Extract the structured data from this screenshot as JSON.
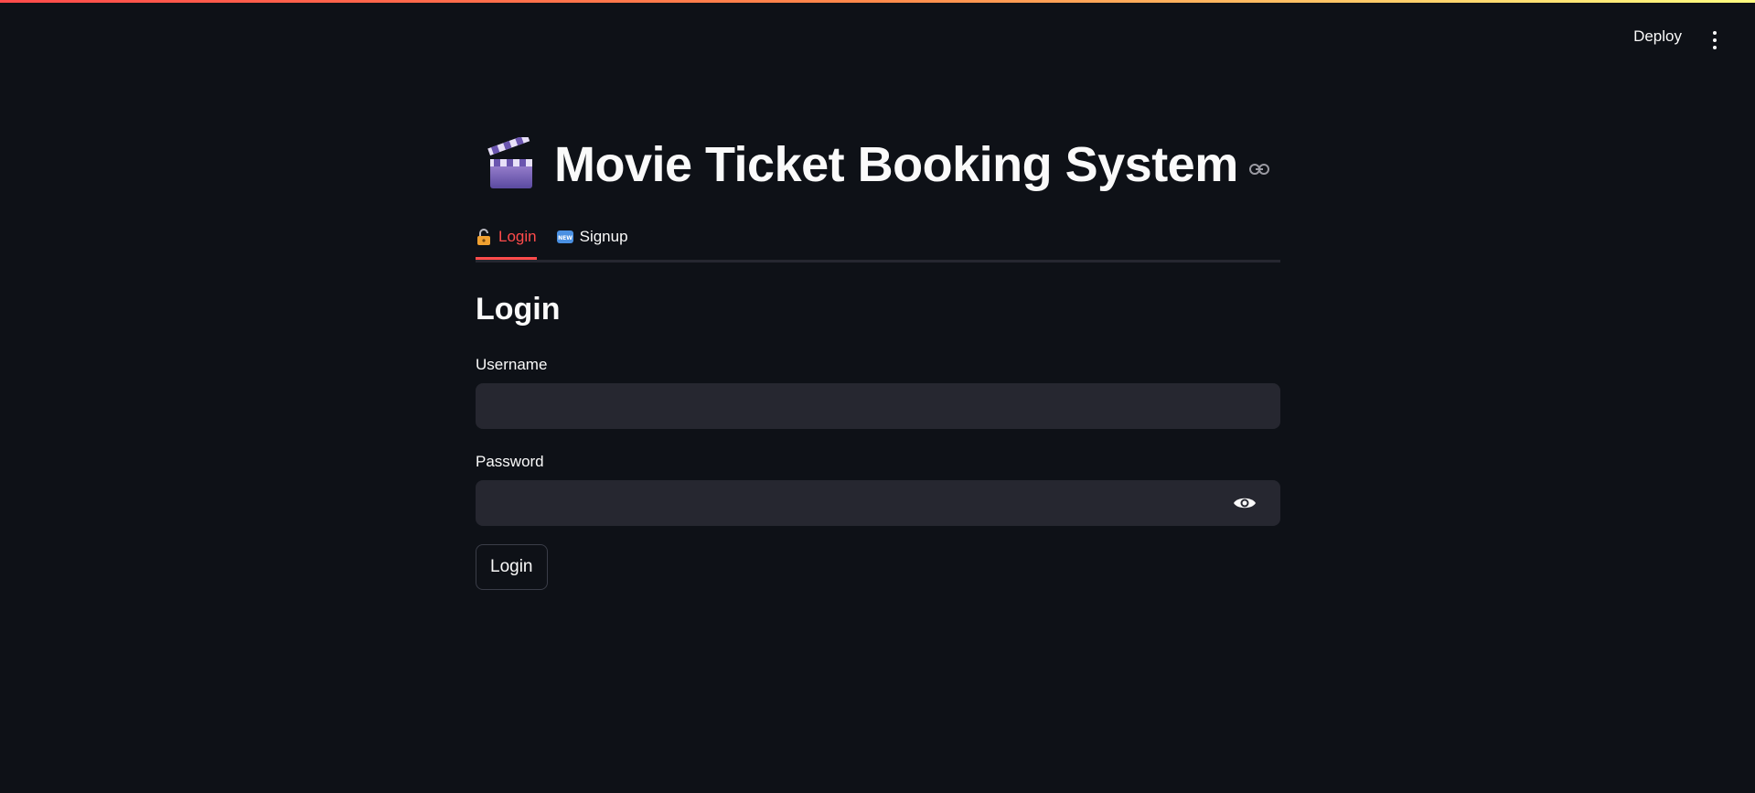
{
  "header": {
    "deploy_label": "Deploy",
    "menu_icon": "kebab-menu-icon",
    "decoration_colors": [
      "#ff4b4b",
      "#fffd80"
    ]
  },
  "main": {
    "title": "Movie Ticket Booking System",
    "title_icon": "clapper-board-icon",
    "tabs": [
      {
        "label": "Login",
        "icon": "lock-icon",
        "active": true
      },
      {
        "label": "Signup",
        "icon": "new-badge-icon",
        "active": false
      }
    ],
    "form": {
      "heading": "Login",
      "username_label": "Username",
      "username_value": "",
      "password_label": "Password",
      "password_value": "",
      "submit_label": "Login"
    }
  },
  "colors": {
    "background": "#0e1117",
    "accent": "#ff4b4b",
    "input_bg": "#262730",
    "text": "#fafafa"
  }
}
